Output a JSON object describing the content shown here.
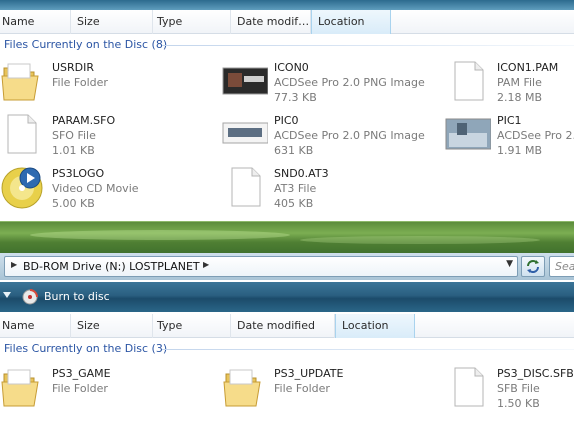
{
  "columns": [
    "Name",
    "Size",
    "Type",
    "Date modif…",
    "Location"
  ],
  "top_pane": {
    "group_title": "Files Currently on the Disc (8)",
    "items": [
      {
        "name": "USRDIR",
        "line2": "File Folder",
        "line3": "",
        "icon": "folder-icon"
      },
      {
        "name": "ICON0",
        "line2": "ACDSee Pro 2.0 PNG Image",
        "line3": "77.3 KB",
        "icon": "image-thumbnail-icon"
      },
      {
        "name": "ICON1.PAM",
        "line2": "PAM File",
        "line3": "2.18 MB",
        "icon": "file-icon"
      },
      {
        "name": "PARAM.SFO",
        "line2": "SFO File",
        "line3": "1.01 KB",
        "icon": "file-icon"
      },
      {
        "name": "PIC0",
        "line2": "ACDSee Pro 2.0 PNG Image",
        "line3": "631 KB",
        "icon": "image-thumbnail-icon"
      },
      {
        "name": "PIC1",
        "line2": "ACDSee Pro 2.",
        "line3": "1.91 MB",
        "icon": "image-thumbnail-icon"
      },
      {
        "name": "PS3LOGO",
        "line2": "Video CD Movie",
        "line3": "5.00 KB",
        "icon": "video-cd-icon"
      },
      {
        "name": "SND0.AT3",
        "line2": "AT3 File",
        "line3": "405 KB",
        "icon": "file-icon"
      }
    ]
  },
  "address_bar": {
    "path": "BD-ROM Drive (N:) LOSTPLANET",
    "search_placeholder": "Sea"
  },
  "toolbar": {
    "burn_label": "Burn to disc"
  },
  "bottom_pane": {
    "columns": [
      "Name",
      "Size",
      "Type",
      "Date modified",
      "Location"
    ],
    "group_title": "Files Currently on the Disc (3)",
    "items": [
      {
        "name": "PS3_GAME",
        "line2": "File Folder",
        "line3": "",
        "icon": "folder-icon"
      },
      {
        "name": "PS3_UPDATE",
        "line2": "File Folder",
        "line3": "",
        "icon": "folder-icon"
      },
      {
        "name": "PS3_DISC.SFB",
        "line2": "SFB File",
        "line3": "1.50 KB",
        "icon": "file-icon"
      }
    ]
  },
  "colors": {
    "group_title": "#2b55a4",
    "toolbar": "#2a5f80",
    "sorted_column": "#d9ecf9"
  }
}
